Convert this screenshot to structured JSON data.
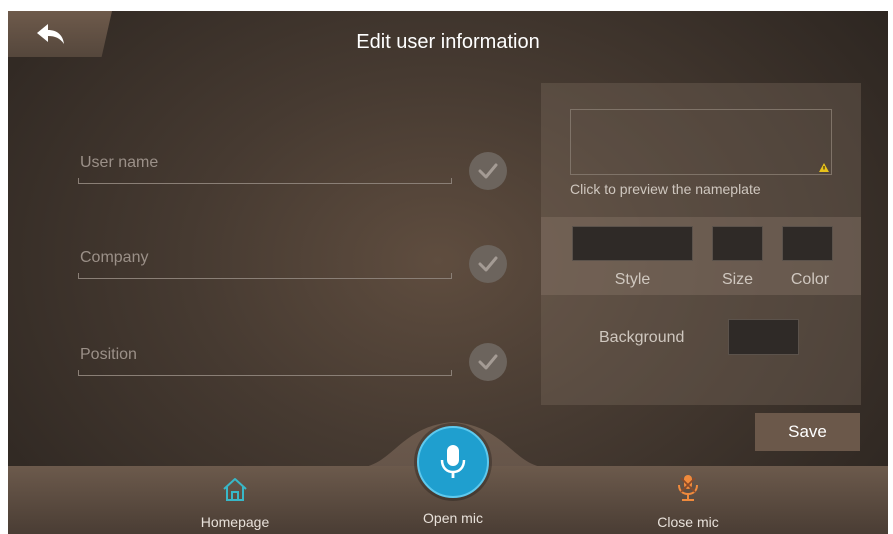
{
  "header": {
    "title": "Edit user information"
  },
  "form": {
    "fields": [
      {
        "name": "user-name",
        "placeholder": "User name",
        "value": ""
      },
      {
        "name": "company",
        "placeholder": "Company",
        "value": ""
      },
      {
        "name": "position",
        "placeholder": "Position",
        "value": ""
      }
    ]
  },
  "nameplate": {
    "preview_label": "Click to preview the nameplate",
    "style_label": "Style",
    "size_label": "Size",
    "color_label": "Color",
    "background_label": "Background"
  },
  "actions": {
    "save_label": "Save"
  },
  "bottom_nav": {
    "homepage_label": "Homepage",
    "open_mic_label": "Open mic",
    "close_mic_label": "Close mic"
  },
  "colors": {
    "accent_mic": "#1f9fcf",
    "close_mic_orange": "#f08a3c",
    "home_icon_teal": "#38b8c8",
    "check_gray": "#6c645d",
    "warning_yellow": "#e8c21a"
  },
  "icons": [
    "back-arrow-icon",
    "check-icon",
    "warning-icon",
    "home-icon",
    "microphone-icon",
    "mic-off-icon"
  ]
}
